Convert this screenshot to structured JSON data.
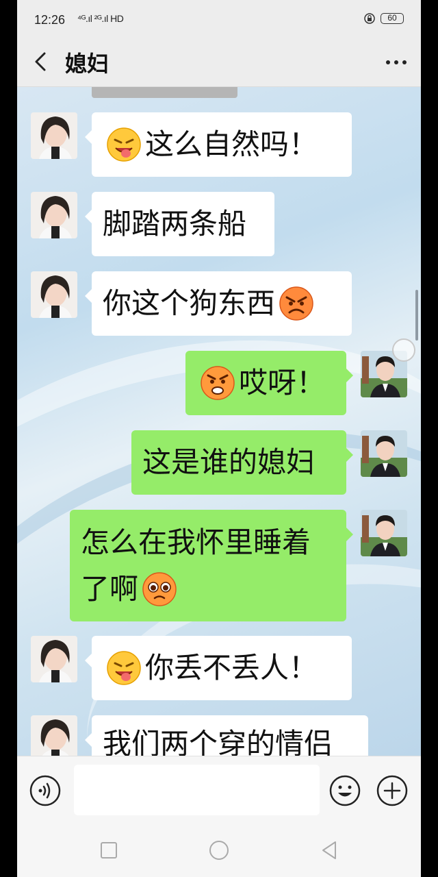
{
  "status": {
    "time": "12:26",
    "network": "⁴ᴳ.ıl ²ᴳ.ıl HD",
    "battery": "60"
  },
  "header": {
    "title": "媳妇",
    "back_icon": "chevron-left-icon",
    "more_icon": "more-dots-icon"
  },
  "messages": [
    {
      "side": "in",
      "emoji_before": "tongue-face-emoji",
      "text": "这么自然吗！"
    },
    {
      "side": "in",
      "text": "脚踏两条船"
    },
    {
      "side": "in",
      "text": "你这个狗东西",
      "emoji_after": "angry-face-emoji"
    },
    {
      "side": "out",
      "emoji_before": "upset-face-emoji",
      "text": "哎呀！"
    },
    {
      "side": "out",
      "text": "这是谁的媳妇"
    },
    {
      "side": "out",
      "text_line1": "怎么在我怀里睡着",
      "text_line2": "了啊",
      "emoji_after": "pleading-face-emoji"
    },
    {
      "side": "in",
      "emoji_before": "tongue-face-emoji",
      "text": "你丢不丢人！"
    },
    {
      "side": "in",
      "text": "我们两个穿的情侣"
    }
  ],
  "colors": {
    "outgoing_bubble": "#95ec69",
    "incoming_bubble": "#ffffff",
    "chat_background": "#cfe3f0"
  },
  "input": {
    "placeholder": "",
    "voice_icon": "voice-icon",
    "emoji_icon": "smiley-icon",
    "plus_icon": "plus-circle-icon"
  },
  "nav": {
    "icons": [
      "square-icon",
      "circle-icon",
      "triangle-back-icon"
    ]
  }
}
